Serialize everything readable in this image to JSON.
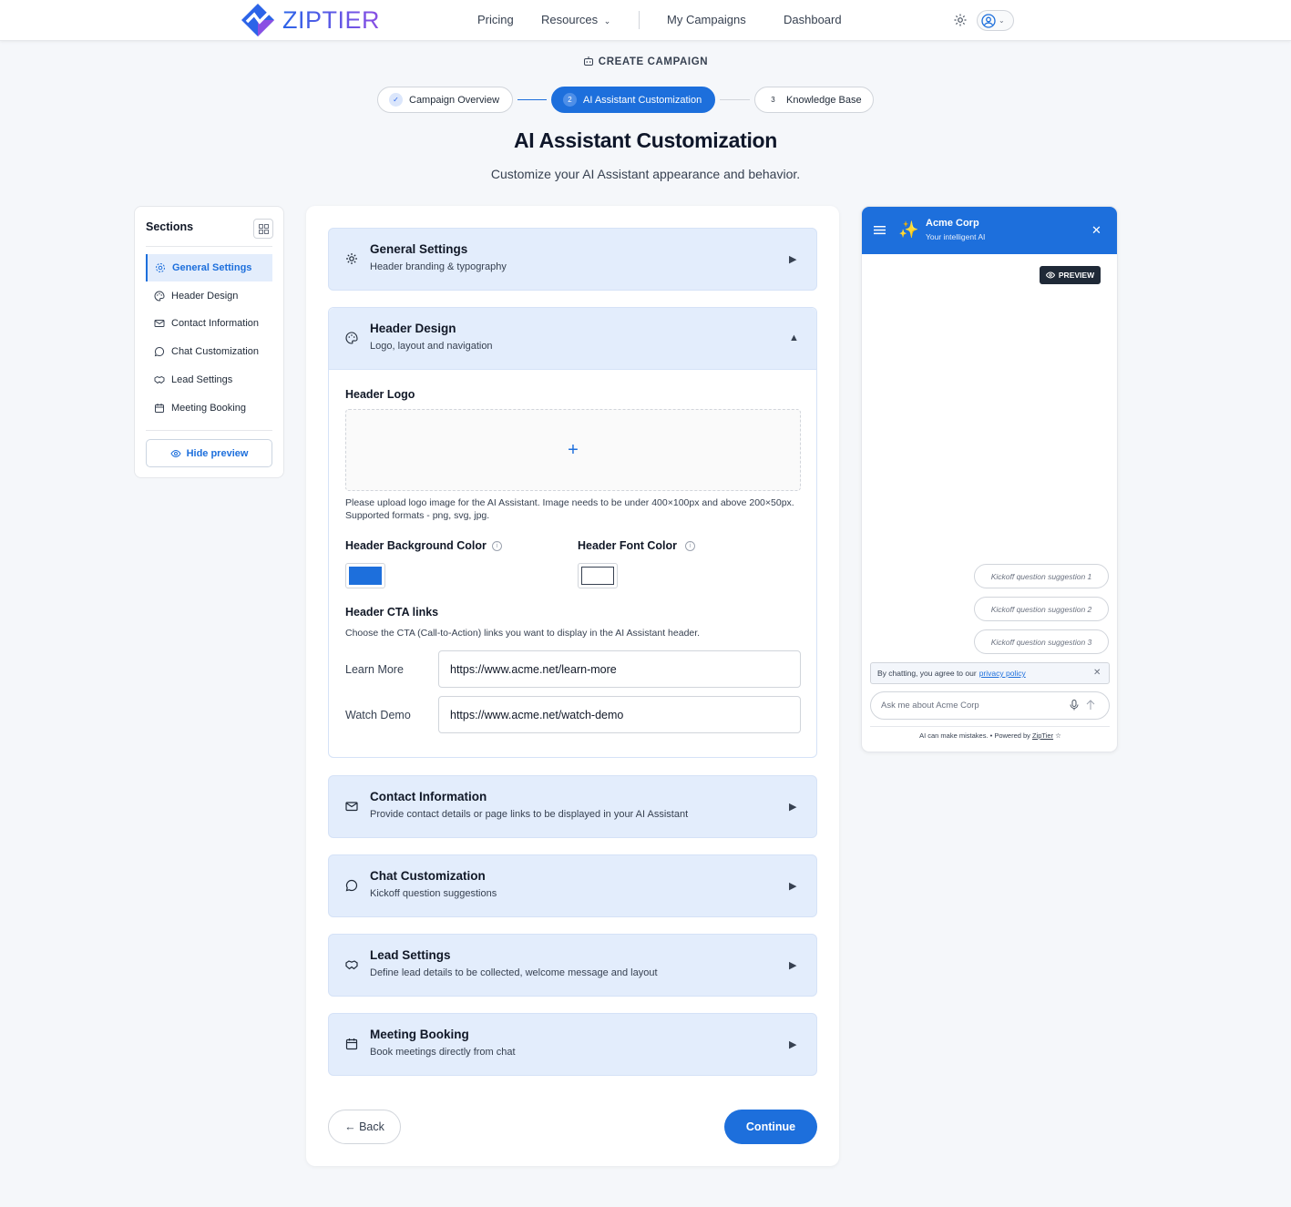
{
  "nav": {
    "logo_text": "ZIPTIER",
    "links": {
      "pricing": "Pricing",
      "resources": "Resources",
      "my_campaigns": "My Campaigns",
      "dashboard": "Dashboard"
    },
    "brand_colors": {
      "primary": "#2c64e8",
      "secondary": "#8a4fe3"
    }
  },
  "header": {
    "create_label": "CREATE CAMPAIGN",
    "steps": [
      {
        "num": "✓",
        "label": "Campaign Overview",
        "state": "done"
      },
      {
        "num": "2",
        "label": "AI Assistant Customization",
        "state": "active"
      },
      {
        "num": "3",
        "label": "Knowledge Base",
        "state": "todo"
      }
    ],
    "title": "AI Assistant Customization",
    "subtitle": "Customize your AI Assistant appearance and behavior."
  },
  "sidebar": {
    "title": "Sections",
    "items": [
      {
        "label": "General Settings",
        "icon": "gear-icon",
        "active": true
      },
      {
        "label": "Header Design",
        "icon": "palette-icon"
      },
      {
        "label": "Contact Information",
        "icon": "mail-icon"
      },
      {
        "label": "Chat Customization",
        "icon": "chat-icon"
      },
      {
        "label": "Lead Settings",
        "icon": "handshake-icon"
      },
      {
        "label": "Meeting Booking",
        "icon": "calendar-icon"
      }
    ],
    "hide_preview": "Hide preview"
  },
  "sections": {
    "general": {
      "title": "General Settings",
      "sub": "Header branding & typography"
    },
    "header_design": {
      "title": "Header Design",
      "sub": "Logo, layout and navigation",
      "logo_label": "Header Logo",
      "upload_plus": "+",
      "logo_help": "Please upload logo image for the AI Assistant. Image needs to be under 400×100px and above 200×50px. Supported formats - png, svg, jpg.",
      "bg_color_label": "Header Background Color",
      "bg_color": "#1d6fdc",
      "font_color_label": "Header Font Color",
      "font_color": "#ffffff",
      "cta_title": "Header CTA links",
      "cta_help": "Choose the CTA (Call-to-Action) links you want to display in the AI Assistant header.",
      "ctas": [
        {
          "label": "Learn More",
          "value": "https://www.acme.net/learn-more"
        },
        {
          "label": "Watch Demo",
          "value": "https://www.acme.net/watch-demo"
        }
      ]
    },
    "contact": {
      "title": "Contact Information",
      "sub": "Provide contact details or page links to be displayed in your AI Assistant"
    },
    "chat": {
      "title": "Chat Customization",
      "sub": "Kickoff question suggestions"
    },
    "lead": {
      "title": "Lead Settings",
      "sub": "Define lead details to be collected, welcome message and layout"
    },
    "meeting": {
      "title": "Meeting Booking",
      "sub": "Book meetings directly from chat"
    }
  },
  "footer": {
    "back": "← Back",
    "continue": "Continue"
  },
  "preview": {
    "company": "Acme Corp",
    "tagline": "Your intelligent AI",
    "badge": "PREVIEW",
    "suggestions": [
      "Kickoff question suggestion 1",
      "Kickoff question suggestion 2",
      "Kickoff question suggestion 3"
    ],
    "consent_text": "By chatting, you agree to our",
    "consent_link": "privacy policy",
    "input_placeholder": "Ask me about Acme Corp",
    "footer_text": "AI can make mistakes. • Powered by",
    "footer_link": "ZipTier"
  }
}
